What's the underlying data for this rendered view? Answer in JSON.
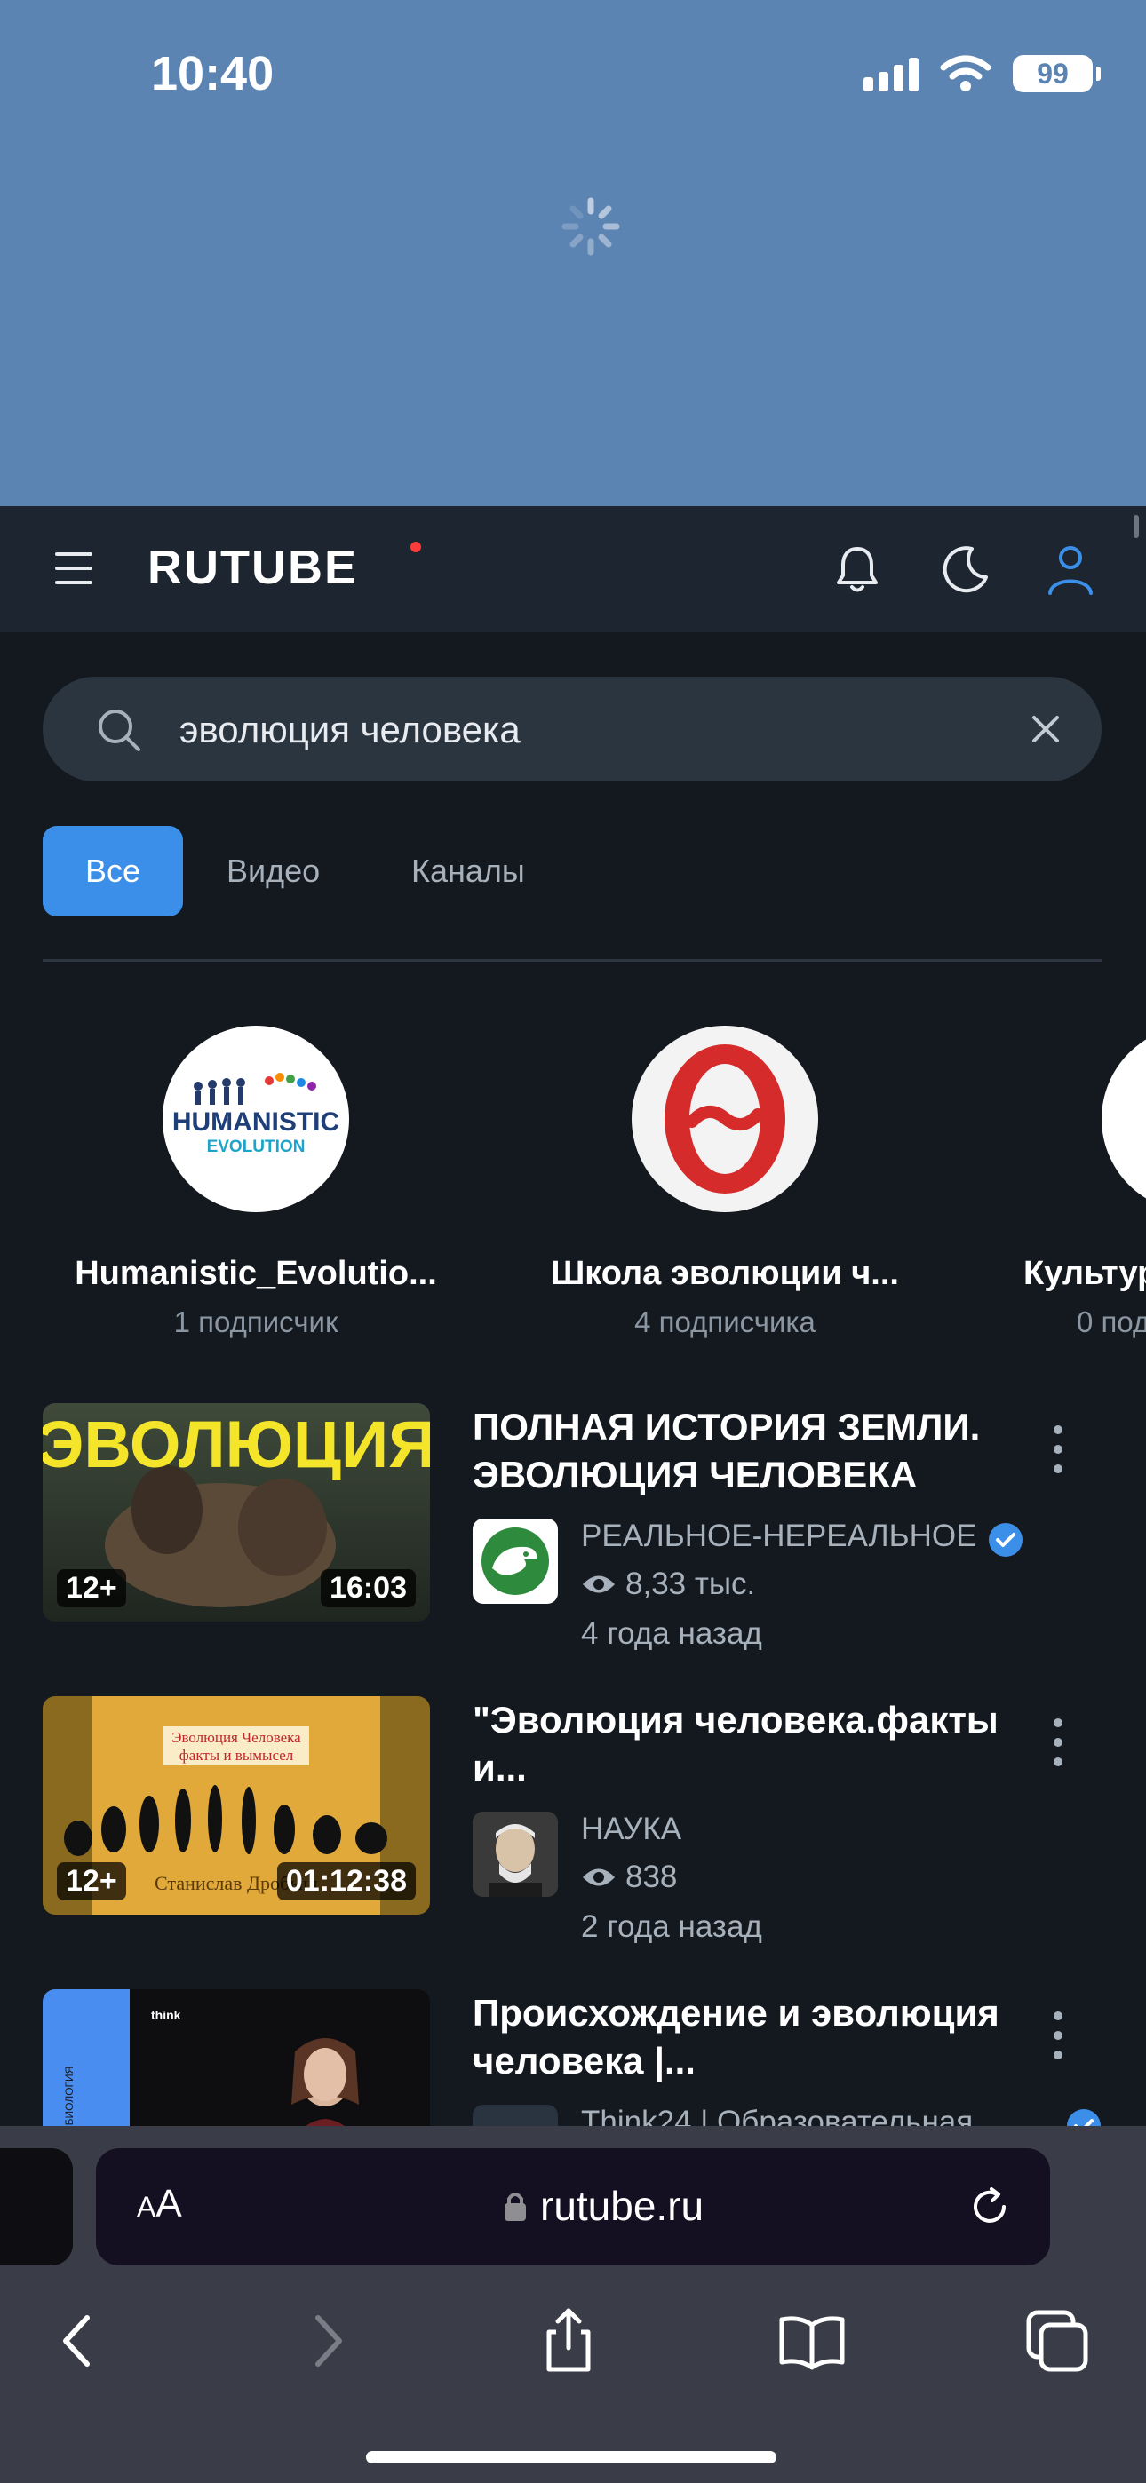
{
  "status_bar": {
    "time": "10:40",
    "battery": "99"
  },
  "header": {
    "logo": "RUTUBE"
  },
  "search": {
    "query": "эволюция человека"
  },
  "filters": [
    {
      "label": "Все",
      "active": true
    },
    {
      "label": "Видео",
      "active": false
    },
    {
      "label": "Каналы",
      "active": false
    }
  ],
  "channels": [
    {
      "name": "Humanistic_Evolutio...",
      "subscribers": "1 подписчик",
      "avatar_text_1": "HUMANISTIC",
      "avatar_text_2": "EVOLUTION"
    },
    {
      "name": "Школа эволюции ч...",
      "subscribers": "4 подписчика"
    },
    {
      "name": "Культур",
      "subscribers": "0 под"
    }
  ],
  "videos": [
    {
      "title": "ПОЛНАЯ ИСТОРИЯ ЗЕМЛИ. ЭВОЛЮЦИЯ ЧЕЛОВЕКА",
      "channel": "РЕАЛЬНОЕ-НЕРЕАЛЬНОЕ",
      "verified": true,
      "views": "8,33 тыс.",
      "date": "4 года назад",
      "age": "12+",
      "duration": "16:03",
      "thumb_text": "ЭВОЛЮЦИЯ"
    },
    {
      "title": "\"Эволюция человека.факты и...",
      "channel": "НАУКА",
      "verified": false,
      "views": "838",
      "date": "2 года назад",
      "age": "12+",
      "duration": "01:12:38",
      "thumb_text_1": "Эволюция Человека",
      "thumb_text_2": "факты и вымысел",
      "thumb_text_3": "Станислав Дробыш"
    },
    {
      "title": "Происхождение и эволюция человека |...",
      "channel": "Think24 | Образовательная",
      "verified": true,
      "thumb_side": "БИОЛОГИЯ",
      "thumb_brand": "think"
    }
  ],
  "safari": {
    "aa_small": "A",
    "aa_big": "A",
    "url": "rutube.ru"
  },
  "colors": {
    "accent": "#3b8fe8",
    "background": "#14191f",
    "header": "#1d2630",
    "loading_area": "#5b84b3"
  }
}
